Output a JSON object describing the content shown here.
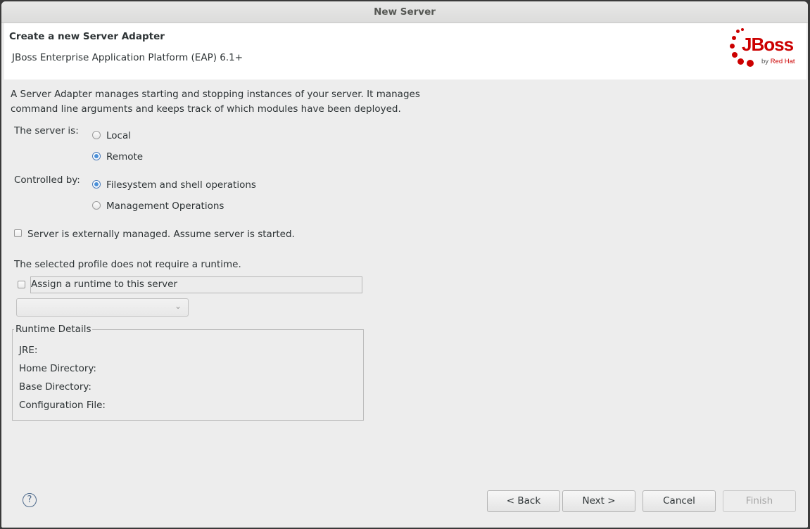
{
  "window": {
    "title": "New Server"
  },
  "banner": {
    "title": "Create a new Server Adapter",
    "subtitle": "JBoss Enterprise Application Platform (EAP) 6.1+",
    "logo_text": "JBoss",
    "logo_by": "by",
    "logo_brand": "Red Hat",
    "brand_color": "#cc0000"
  },
  "description": {
    "line1": "A Server Adapter manages starting and stopping instances of your server. It manages",
    "line2": "command line arguments and keeps track of which modules have been deployed."
  },
  "server_location": {
    "label": "The server is:",
    "options": [
      {
        "label": "Local",
        "selected": false
      },
      {
        "label": "Remote",
        "selected": true
      }
    ]
  },
  "controlled_by": {
    "label": "Controlled by:",
    "options": [
      {
        "label": "Filesystem and shell operations",
        "selected": true
      },
      {
        "label": "Management Operations",
        "selected": false
      }
    ]
  },
  "externally_managed": {
    "label": "Server is externally managed. Assume server is started.",
    "checked": false
  },
  "runtime": {
    "note": "The selected profile does not require a runtime.",
    "assign_label": "Assign a runtime to this server",
    "assign_checked": false,
    "selected_value": ""
  },
  "runtime_details": {
    "title": "Runtime Details",
    "jre_label": "JRE:",
    "home_label": "Home Directory:",
    "base_label": "Base Directory:",
    "config_label": "Configuration File:"
  },
  "footer": {
    "help_icon": "question-circle-icon",
    "help_glyph": "?",
    "back_label": "< Back",
    "next_label": "Next >",
    "cancel_label": "Cancel",
    "finish_label": "Finish"
  }
}
